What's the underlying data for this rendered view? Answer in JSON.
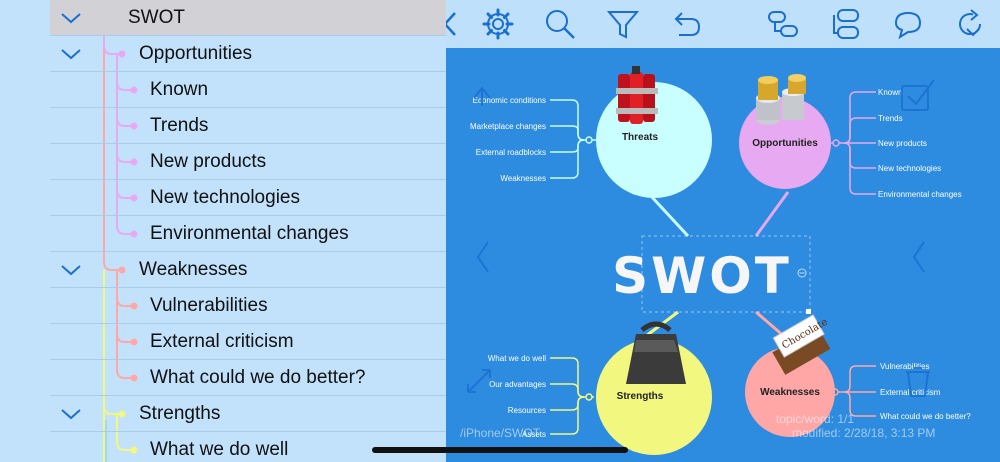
{
  "outline": {
    "rows": [
      {
        "label": "SWOT",
        "level": 0,
        "expanded": true,
        "selected": true
      },
      {
        "label": "Opportunities",
        "level": 1,
        "expanded": true
      },
      {
        "label": "Known",
        "level": 2
      },
      {
        "label": "Trends",
        "level": 2
      },
      {
        "label": "New products",
        "level": 2
      },
      {
        "label": "New technologies",
        "level": 2
      },
      {
        "label": "Environmental changes",
        "level": 2
      },
      {
        "label": "Weaknesses",
        "level": 1,
        "expanded": true
      },
      {
        "label": "Vulnerabilities",
        "level": 2
      },
      {
        "label": "External criticism",
        "level": 2
      },
      {
        "label": "What could we do better?",
        "level": 2
      },
      {
        "label": "Strengths",
        "level": 1,
        "expanded": true
      },
      {
        "label": "What we do well",
        "level": 2
      }
    ]
  },
  "toolbar": {
    "icons": [
      "chevron-left-icon",
      "gear-icon",
      "search-icon",
      "filter-icon",
      "undo-icon",
      "add-child-icon",
      "add-sibling-icon",
      "comment-icon",
      "refresh-icon"
    ]
  },
  "map": {
    "center": "SWOT",
    "threats": {
      "label": "Threats",
      "items": [
        "Economic conditions",
        "Marketplace changes",
        "External roadblocks",
        "Weaknesses"
      ]
    },
    "opportunities": {
      "label": "Opportunities",
      "items": [
        "Known",
        "Trends",
        "New products",
        "New technologies",
        "Environmental changes"
      ]
    },
    "strengths": {
      "label": "Strengths",
      "items": [
        "What we do well",
        "Our advantages",
        "Resources",
        "Assets"
      ]
    },
    "weaknesses": {
      "label": "Weaknesses",
      "items": [
        "Vulnerabilities",
        "External criticism",
        "What could we do better?"
      ]
    },
    "chocolate_label": "Chocolate",
    "path": "/iPhone/SWOT",
    "stats": "topic/word: 1/1",
    "modified": "modified: 2/28/18, 3:13 PM"
  },
  "colors": {
    "root": "#d4a6ef",
    "opportunities": "#e7a9f1",
    "weaknesses": "#ffa7a7",
    "strengths": "#f2f77f",
    "threats": "#c9ffff",
    "map_bg": "#2d8be0",
    "accent": "#1b6fd1"
  }
}
